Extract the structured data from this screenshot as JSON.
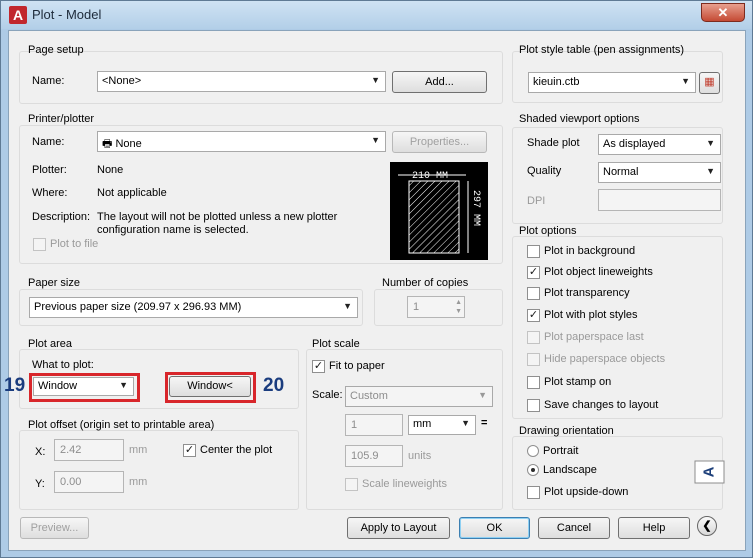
{
  "window": {
    "title": "Plot - Model",
    "close": "✕"
  },
  "page_setup": {
    "legend": "Page setup",
    "name_label": "Name:",
    "name_value": "<None>",
    "add_button": "Add..."
  },
  "printer": {
    "legend": "Printer/plotter",
    "name_label": "Name:",
    "name_value": "None",
    "properties_button": "Properties...",
    "plotter_label": "Plotter:",
    "plotter_value": "None",
    "where_label": "Where:",
    "where_value": "Not applicable",
    "description_label": "Description:",
    "description_value_1": "The layout will not be plotted unless a new plotter",
    "description_value_2": "configuration name is selected.",
    "plot_to_file": "Plot to file"
  },
  "preview": {
    "width_text": "210 MM",
    "height_text": "297 MM"
  },
  "paper_size": {
    "legend": "Paper size",
    "value": "Previous paper size (209.97 x 296.93 MM)"
  },
  "copies": {
    "legend": "Number of copies",
    "value": "1"
  },
  "plot_area": {
    "legend": "Plot area",
    "what_label": "What to plot:",
    "what_value": "Window",
    "window_button": "Window<"
  },
  "badges": {
    "b19": "19",
    "b20": "20"
  },
  "plot_offset": {
    "legend": "Plot offset (origin set to printable area)",
    "x_label": "X:",
    "x_value": "2.42",
    "x_unit": "mm",
    "y_label": "Y:",
    "y_value": "0.00",
    "y_unit": "mm",
    "center": "Center the plot"
  },
  "plot_scale": {
    "legend": "Plot scale",
    "fit": "Fit to paper",
    "scale_label": "Scale:",
    "scale_value": "Custom",
    "value1": "1",
    "unit": "mm",
    "equals": "=",
    "value2": "105.9",
    "units": "units",
    "scale_lw": "Scale lineweights"
  },
  "pen": {
    "legend": "Plot style table (pen assignments)",
    "value": "kieuin.ctb"
  },
  "shaded": {
    "legend": "Shaded viewport options",
    "shade_label": "Shade plot",
    "shade_value": "As displayed",
    "quality_label": "Quality",
    "quality_value": "Normal",
    "dpi_label": "DPI"
  },
  "plot_options": {
    "legend": "Plot options",
    "items": [
      "Plot in background",
      "Plot object lineweights",
      "Plot transparency",
      "Plot with plot styles",
      "Plot paperspace last",
      "Hide paperspace objects",
      "Plot stamp on",
      "Save changes to layout"
    ]
  },
  "orientation": {
    "legend": "Drawing orientation",
    "portrait": "Portrait",
    "landscape": "Landscape",
    "upside": "Plot upside-down",
    "icon": "A"
  },
  "footer": {
    "preview": "Preview...",
    "apply": "Apply to Layout",
    "ok": "OK",
    "cancel": "Cancel",
    "help": "Help",
    "more": "❮"
  }
}
